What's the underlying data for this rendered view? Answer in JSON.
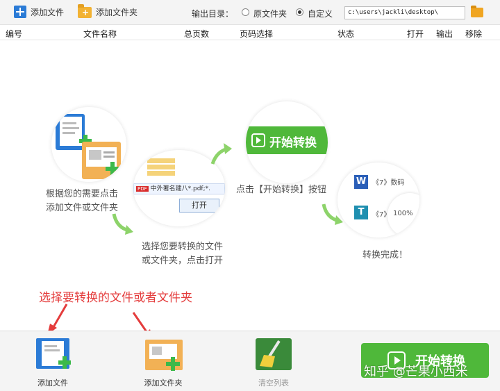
{
  "toolbar": {
    "add_file": "添加文件",
    "add_folder": "添加文件夹",
    "output_dir_label": "输出目录：",
    "radio_original": "原文件夹",
    "radio_custom": "自定义",
    "selected_radio": "自定义",
    "output_path": "c:\\users\\jackli\\desktop\\"
  },
  "columns": [
    "编号",
    "文件名称",
    "总页数",
    "页码选择",
    "状态",
    "打开",
    "输出",
    "移除"
  ],
  "guide": {
    "step1": [
      "根据您的需要点击",
      "添加文件或文件夹"
    ],
    "step2": [
      "选择您要转换的文件",
      "或文件夹，点击打开"
    ],
    "step2_file_hint": "中外著名建八*.pdf;*.",
    "step2_open_button": "打开",
    "step2_list_items": [
      "",
      "",
      "",
      ""
    ],
    "step3": "点击【开始转换】按钮",
    "step3_button": "开始转换",
    "step4": "转换完成！",
    "step4_item1": "《7》数码",
    "step4_item2": "《7》",
    "step4_progress": "100%",
    "step4_status": "完成",
    "hint_red": "选择要转换的文件或者文件夹"
  },
  "bottombar": {
    "add_file": "添加文件",
    "add_folder": "添加文件夹",
    "clear_list": "清空列表",
    "start_convert": "开始转换",
    "watermark": "知乎 @芒果小西米"
  },
  "colors": {
    "accent_green": "#4fb83a",
    "accent_blue": "#2b7bd6",
    "hint_red": "#e43c3c"
  }
}
